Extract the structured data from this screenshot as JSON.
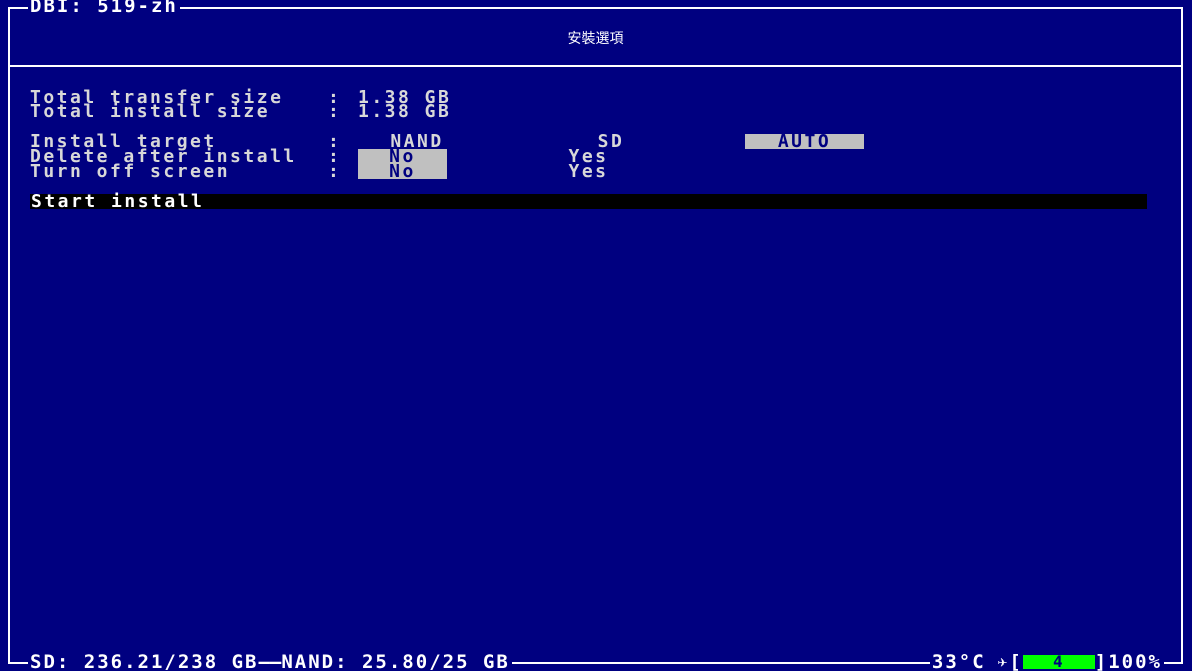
{
  "app": {
    "title": "DBI: 519-zh"
  },
  "header": {
    "title": "安裝選項"
  },
  "summary": {
    "transfer_label": "Total transfer size",
    "transfer_value": "1.38 GB",
    "install_label": "Total install size",
    "install_value": "1.38 GB"
  },
  "options": {
    "separator": ":",
    "install_target": {
      "label": "Install target",
      "choices": [
        "NAND",
        "SD",
        "AUTO"
      ],
      "selected": "AUTO"
    },
    "delete_after_install": {
      "label": "Delete after install",
      "choices": [
        "No",
        "Yes"
      ],
      "selected": "No"
    },
    "turn_off_screen": {
      "label": "Turn off screen",
      "choices": [
        "No",
        "Yes"
      ],
      "selected": "No"
    }
  },
  "action": {
    "start_label": "Start install"
  },
  "status": {
    "sd": "SD: 236.21/238 GB",
    "nand": "NAND: 25.80/25 GB",
    "temperature": "33°C",
    "airplane_icon": "✈",
    "battery_open": "[",
    "battery_level": "4",
    "battery_close": "]",
    "battery_percent": "100%",
    "colors": {
      "background": "#000080",
      "highlight": "#c0c0c0",
      "battery": "#00ff00"
    }
  }
}
